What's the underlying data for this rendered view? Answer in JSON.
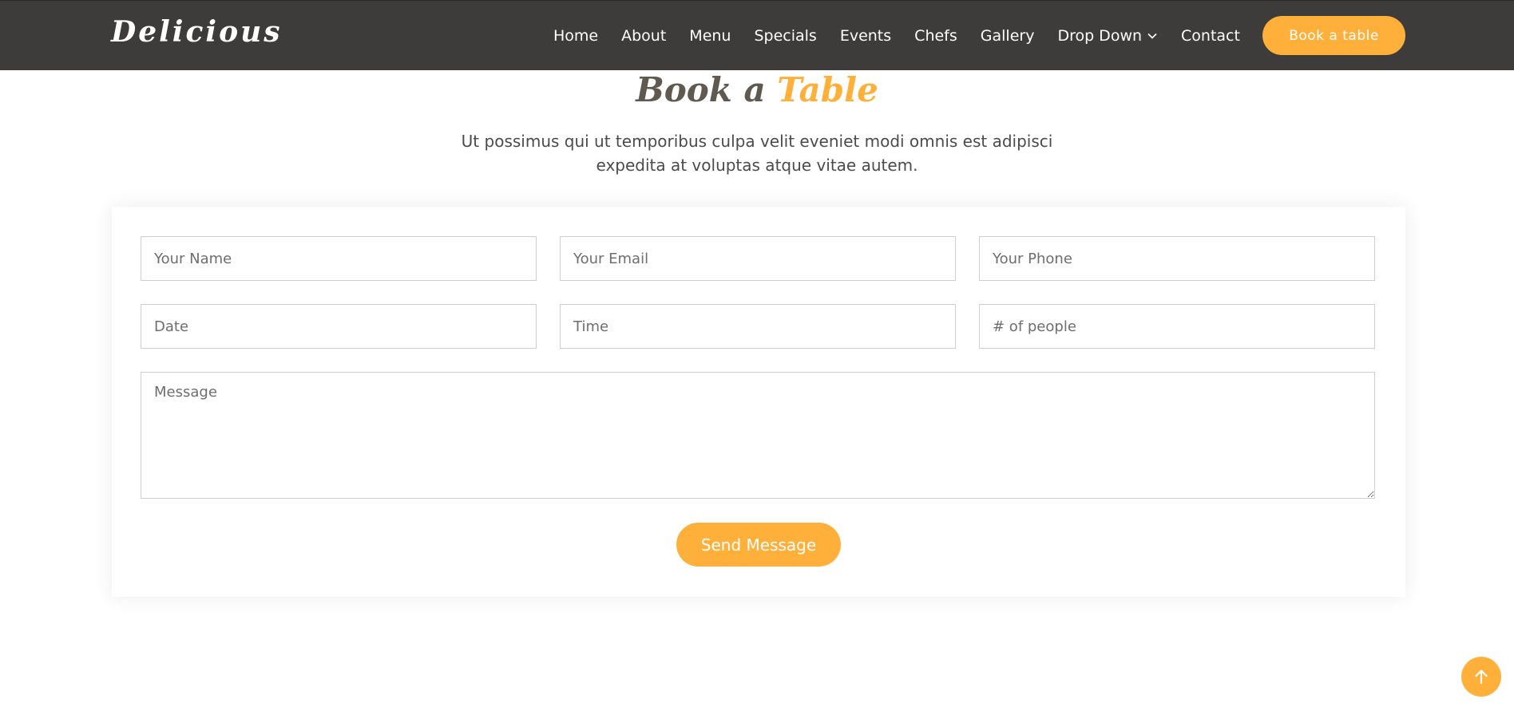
{
  "brand": {
    "logo": "Delicious"
  },
  "nav": {
    "items": [
      {
        "label": "Home"
      },
      {
        "label": "About"
      },
      {
        "label": "Menu"
      },
      {
        "label": "Specials"
      },
      {
        "label": "Events"
      },
      {
        "label": "Chefs"
      },
      {
        "label": "Gallery"
      },
      {
        "label": "Drop Down",
        "icon": "chevron-down-icon"
      },
      {
        "label": "Contact"
      }
    ],
    "cta_label": "Book a table"
  },
  "section": {
    "title_part1": "Book a ",
    "title_part2": "Table",
    "description": "Ut possimus qui ut temporibus culpa velit eveniet modi omnis est adipisci expedita at voluptas atque vitae autem."
  },
  "form": {
    "name_placeholder": "Your Name",
    "email_placeholder": "Your Email",
    "phone_placeholder": "Your Phone",
    "date_placeholder": "Date",
    "time_placeholder": "Time",
    "people_placeholder": "# of people",
    "message_placeholder": "Message",
    "submit_label": "Send Message"
  },
  "back_to_top": {
    "icon": "arrow-up-icon"
  },
  "colors": {
    "accent": "#ffb03b",
    "header_bg": "#3e3c3a",
    "title_text": "#5f5950"
  }
}
